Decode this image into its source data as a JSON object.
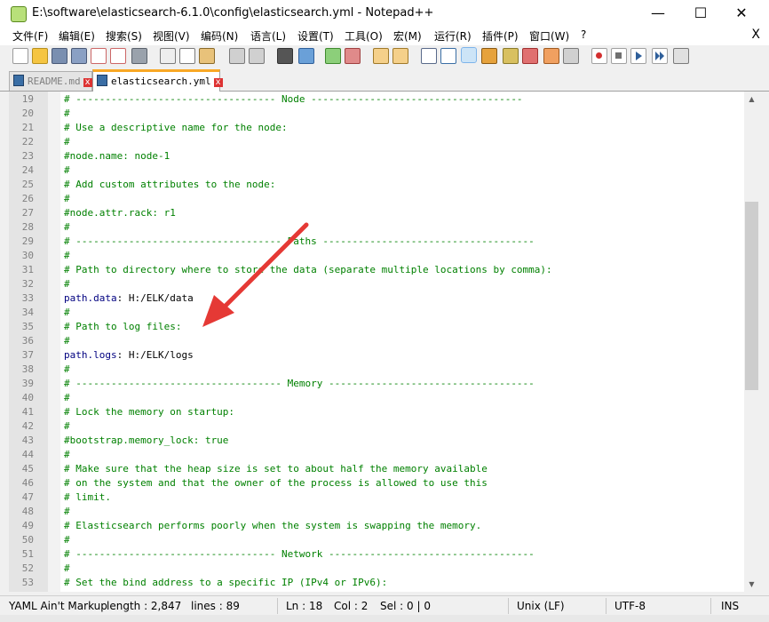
{
  "window": {
    "title": "E:\\software\\elasticsearch-6.1.0\\config\\elasticsearch.yml - Notepad++",
    "minimize": "—",
    "maximize": "☐",
    "close": "✕"
  },
  "menu": {
    "items": [
      "文件(F)",
      "编辑(E)",
      "搜索(S)",
      "视图(V)",
      "编码(N)",
      "语言(L)",
      "设置(T)",
      "工具(O)",
      "宏(M)",
      "运行(R)",
      "插件(P)",
      "窗口(W)",
      "?"
    ],
    "close": "X"
  },
  "tabs": [
    {
      "label": "README.md"
    },
    {
      "label": "elasticsearch.yml"
    }
  ],
  "editor": {
    "lines": [
      {
        "n": "19",
        "t": "comment",
        "text": "# ---------------------------------- Node ------------------------------------"
      },
      {
        "n": "20",
        "t": "comment",
        "text": "#"
      },
      {
        "n": "21",
        "t": "comment",
        "text": "# Use a descriptive name for the node:"
      },
      {
        "n": "22",
        "t": "comment",
        "text": "#"
      },
      {
        "n": "23",
        "t": "comment",
        "text": "#node.name: node-1"
      },
      {
        "n": "24",
        "t": "comment",
        "text": "#"
      },
      {
        "n": "25",
        "t": "comment",
        "text": "# Add custom attributes to the node:"
      },
      {
        "n": "26",
        "t": "comment",
        "text": "#"
      },
      {
        "n": "27",
        "t": "comment",
        "text": "#node.attr.rack: r1"
      },
      {
        "n": "28",
        "t": "comment",
        "text": "#"
      },
      {
        "n": "29",
        "t": "comment",
        "text": "# ----------------------------------- Paths ------------------------------------"
      },
      {
        "n": "30",
        "t": "comment",
        "text": "#"
      },
      {
        "n": "31",
        "t": "comment",
        "text": "# Path to directory where to store the data (separate multiple locations by comma):"
      },
      {
        "n": "32",
        "t": "comment",
        "text": "#"
      },
      {
        "n": "33",
        "t": "kv",
        "key": "path.data",
        "value": " H:/ELK/data"
      },
      {
        "n": "34",
        "t": "comment",
        "text": "#"
      },
      {
        "n": "35",
        "t": "comment",
        "text": "# Path to log files:"
      },
      {
        "n": "36",
        "t": "comment",
        "text": "#"
      },
      {
        "n": "37",
        "t": "kv",
        "key": "path.logs",
        "value": " H:/ELK/logs"
      },
      {
        "n": "38",
        "t": "comment",
        "text": "#"
      },
      {
        "n": "39",
        "t": "comment",
        "text": "# ----------------------------------- Memory -----------------------------------"
      },
      {
        "n": "40",
        "t": "comment",
        "text": "#"
      },
      {
        "n": "41",
        "t": "comment",
        "text": "# Lock the memory on startup:"
      },
      {
        "n": "42",
        "t": "comment",
        "text": "#"
      },
      {
        "n": "43",
        "t": "comment",
        "text": "#bootstrap.memory_lock: true"
      },
      {
        "n": "44",
        "t": "comment",
        "text": "#"
      },
      {
        "n": "45",
        "t": "comment",
        "text": "# Make sure that the heap size is set to about half the memory available"
      },
      {
        "n": "46",
        "t": "comment",
        "text": "# on the system and that the owner of the process is allowed to use this"
      },
      {
        "n": "47",
        "t": "comment",
        "text": "# limit."
      },
      {
        "n": "48",
        "t": "comment",
        "text": "#"
      },
      {
        "n": "49",
        "t": "comment",
        "text": "# Elasticsearch performs poorly when the system is swapping the memory."
      },
      {
        "n": "50",
        "t": "comment",
        "text": "#"
      },
      {
        "n": "51",
        "t": "comment",
        "text": "# ---------------------------------- Network -----------------------------------"
      },
      {
        "n": "52",
        "t": "comment",
        "text": "#"
      },
      {
        "n": "53",
        "t": "comment",
        "text": "# Set the bind address to a specific IP (IPv4 or IPv6):"
      }
    ]
  },
  "status": {
    "language": "YAML Ain't Markup",
    "length": "length : 2,847",
    "lines": "lines : 89",
    "ln": "Ln : 18",
    "col": "Col : 2",
    "sel": "Sel : 0 | 0",
    "eol": "Unix (LF)",
    "encoding": "UTF-8",
    "mode": "INS"
  },
  "colors": {
    "comment": "#008000",
    "key": "#000080",
    "arrow": "#e53935",
    "tab_accent": "#f9a825"
  }
}
